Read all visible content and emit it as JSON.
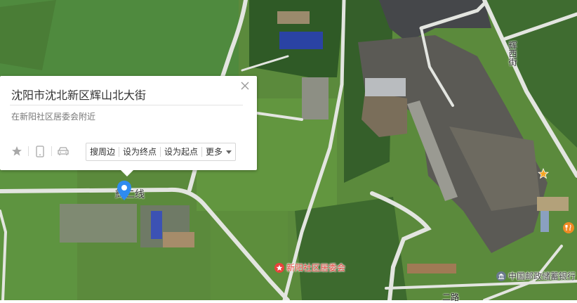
{
  "popup": {
    "title": "沈阳市沈北新区辉山北大街",
    "address": "在新阳社区居委会附近",
    "actions": [
      "搜周边",
      "设为终点",
      "设为起点",
      "更多"
    ],
    "icons": [
      "star-icon",
      "phone-icon",
      "car-icon"
    ]
  },
  "map": {
    "road_labels": [
      "辉二线",
      "辉西街",
      "二路"
    ],
    "poi_labels": [
      "新阳社区居委会",
      "中国邮政储蓄银行"
    ],
    "colors": {
      "satellite_green": "#5f8f3a",
      "road": "#e6e6e6",
      "marker": "#2f8bf0",
      "poi_red": "#e8433c"
    }
  }
}
